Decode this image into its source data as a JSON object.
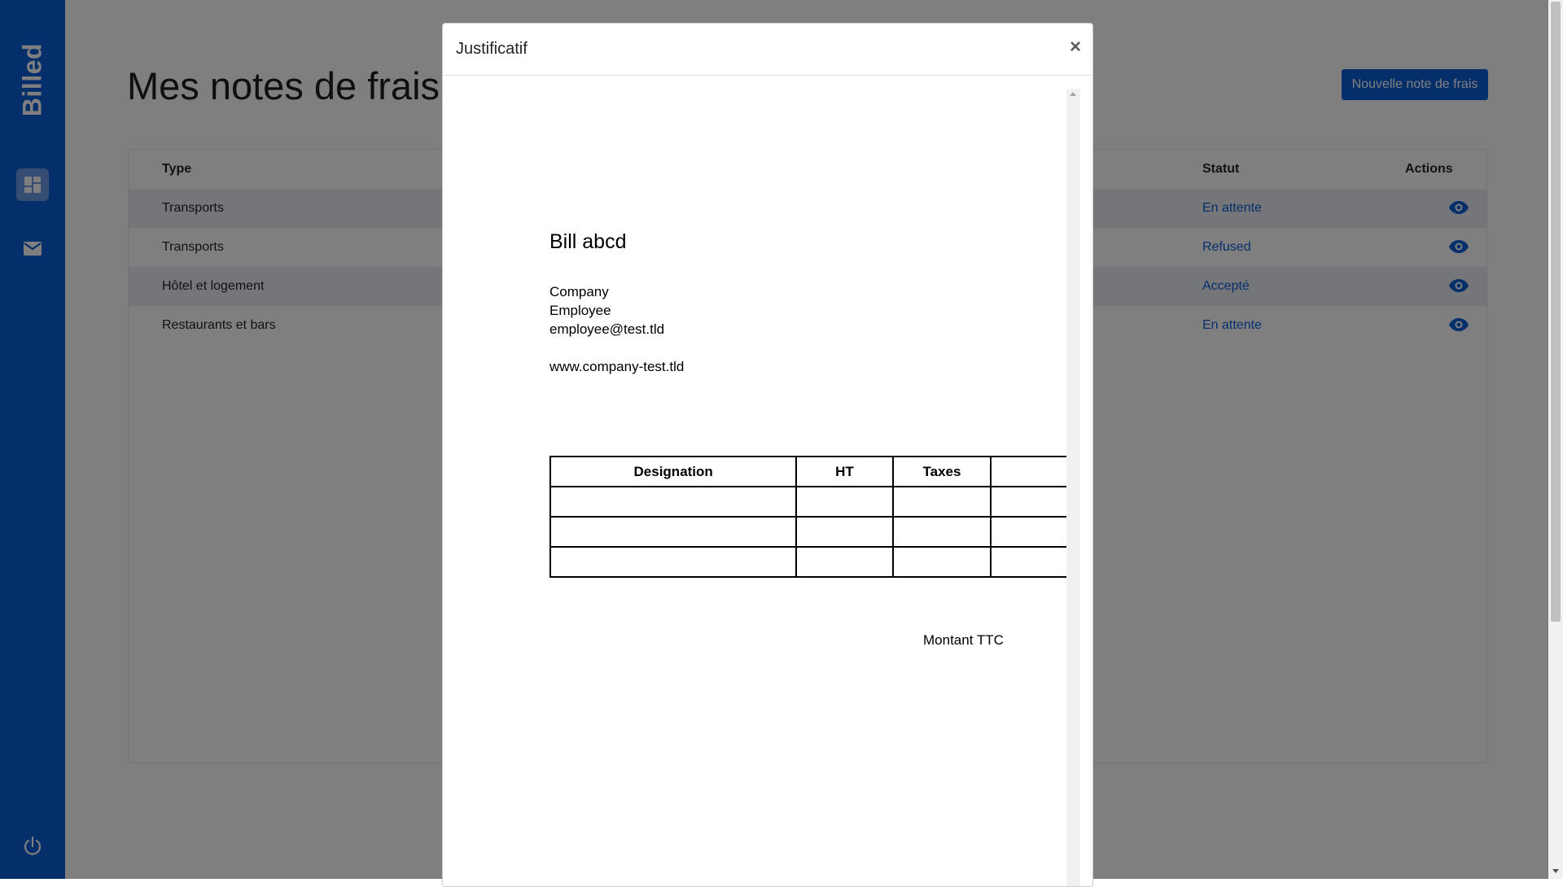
{
  "sidebar": {
    "logo": "Billed",
    "icons": [
      "dashboard-icon",
      "mail-icon",
      "power-icon"
    ],
    "color": "#0b5ed7"
  },
  "main": {
    "title": "Mes notes de frais",
    "new_button": "Nouvelle note de frais",
    "table": {
      "headers": {
        "type": "Type",
        "statut": "Statut",
        "actions": "Actions"
      },
      "rows": [
        {
          "type": "Transports",
          "statut": "En attente"
        },
        {
          "type": "Transports",
          "statut": "Refused"
        },
        {
          "type": "Hôtel et logement",
          "statut": "Accepté"
        },
        {
          "type": "Restaurants et bars",
          "statut": "En attente"
        }
      ]
    }
  },
  "modal": {
    "title": "Justificatif",
    "close": "×",
    "document": {
      "title": "Bill abcd",
      "company": "Company",
      "employee": "Employee",
      "email": "employee@test.tld",
      "website": "www.company-test.tld",
      "table_headers": [
        "Designation",
        "HT",
        "Taxes"
      ],
      "total_label": "Montant TTC"
    }
  }
}
